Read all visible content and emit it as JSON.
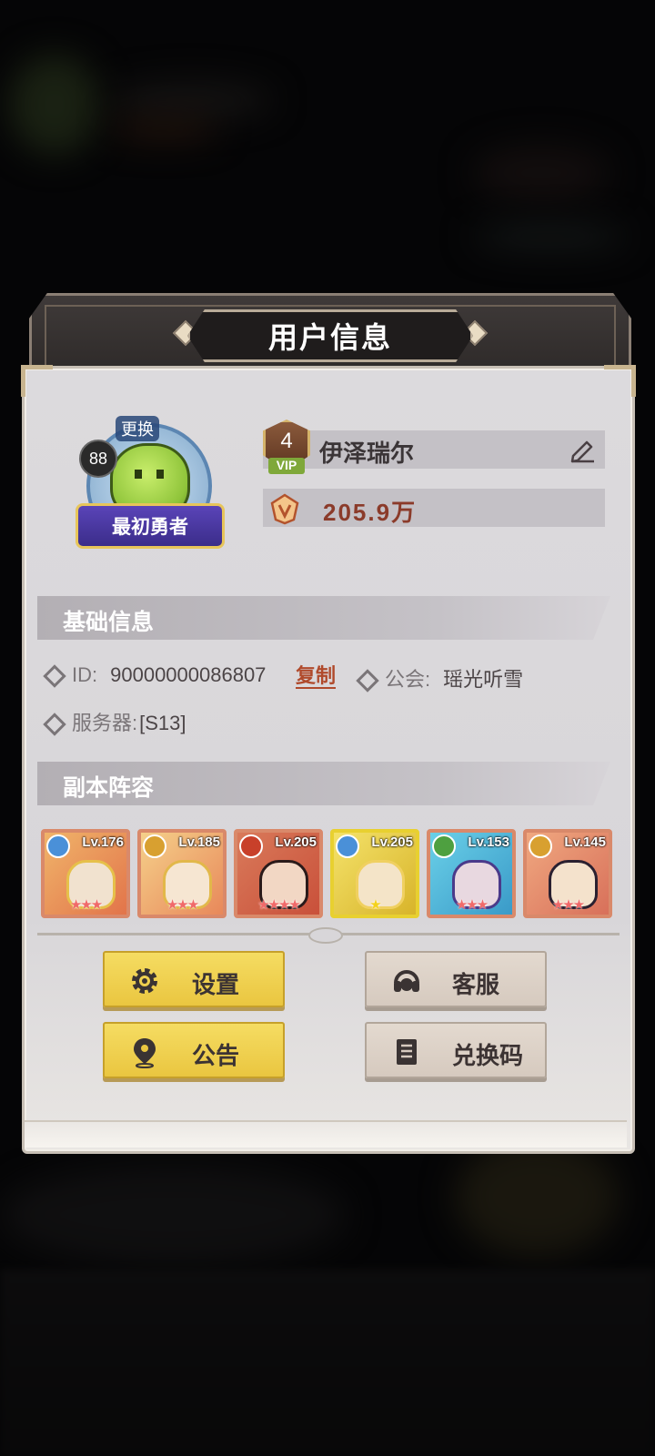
{
  "dialog": {
    "title": "用户信息"
  },
  "profile": {
    "avatar_change_label": "更换",
    "avatar_level": "88",
    "avatar_title": "最初勇者",
    "vip_level": "4",
    "vip_label": "VIP",
    "player_name": "伊泽瑞尔",
    "power_value": "205.9万"
  },
  "basic_info": {
    "header": "基础信息",
    "id_label": "ID:",
    "id_value": "90000000086807",
    "copy_label": "复制",
    "guild_label": "公会:",
    "guild_value": "瑶光听雪",
    "server_label": "服务器:",
    "server_value": "[S13]"
  },
  "lineup": {
    "header": "副本阵容",
    "heroes": [
      {
        "level": "Lv.176",
        "stars": "★★★"
      },
      {
        "level": "Lv.185",
        "stars": "★★★"
      },
      {
        "level": "Lv.205",
        "stars": "★★★★"
      },
      {
        "level": "Lv.205",
        "stars": "★"
      },
      {
        "level": "Lv.153",
        "stars": "★★★"
      },
      {
        "level": "Lv.145",
        "stars": "★★★"
      }
    ]
  },
  "buttons": {
    "settings": "设置",
    "customer_service": "客服",
    "announcement": "公告",
    "redeem_code": "兑换码"
  },
  "colors": {
    "accent_yellow": "#eac640",
    "copy_link": "#b04a2c",
    "power_text": "#8b3b2a"
  }
}
